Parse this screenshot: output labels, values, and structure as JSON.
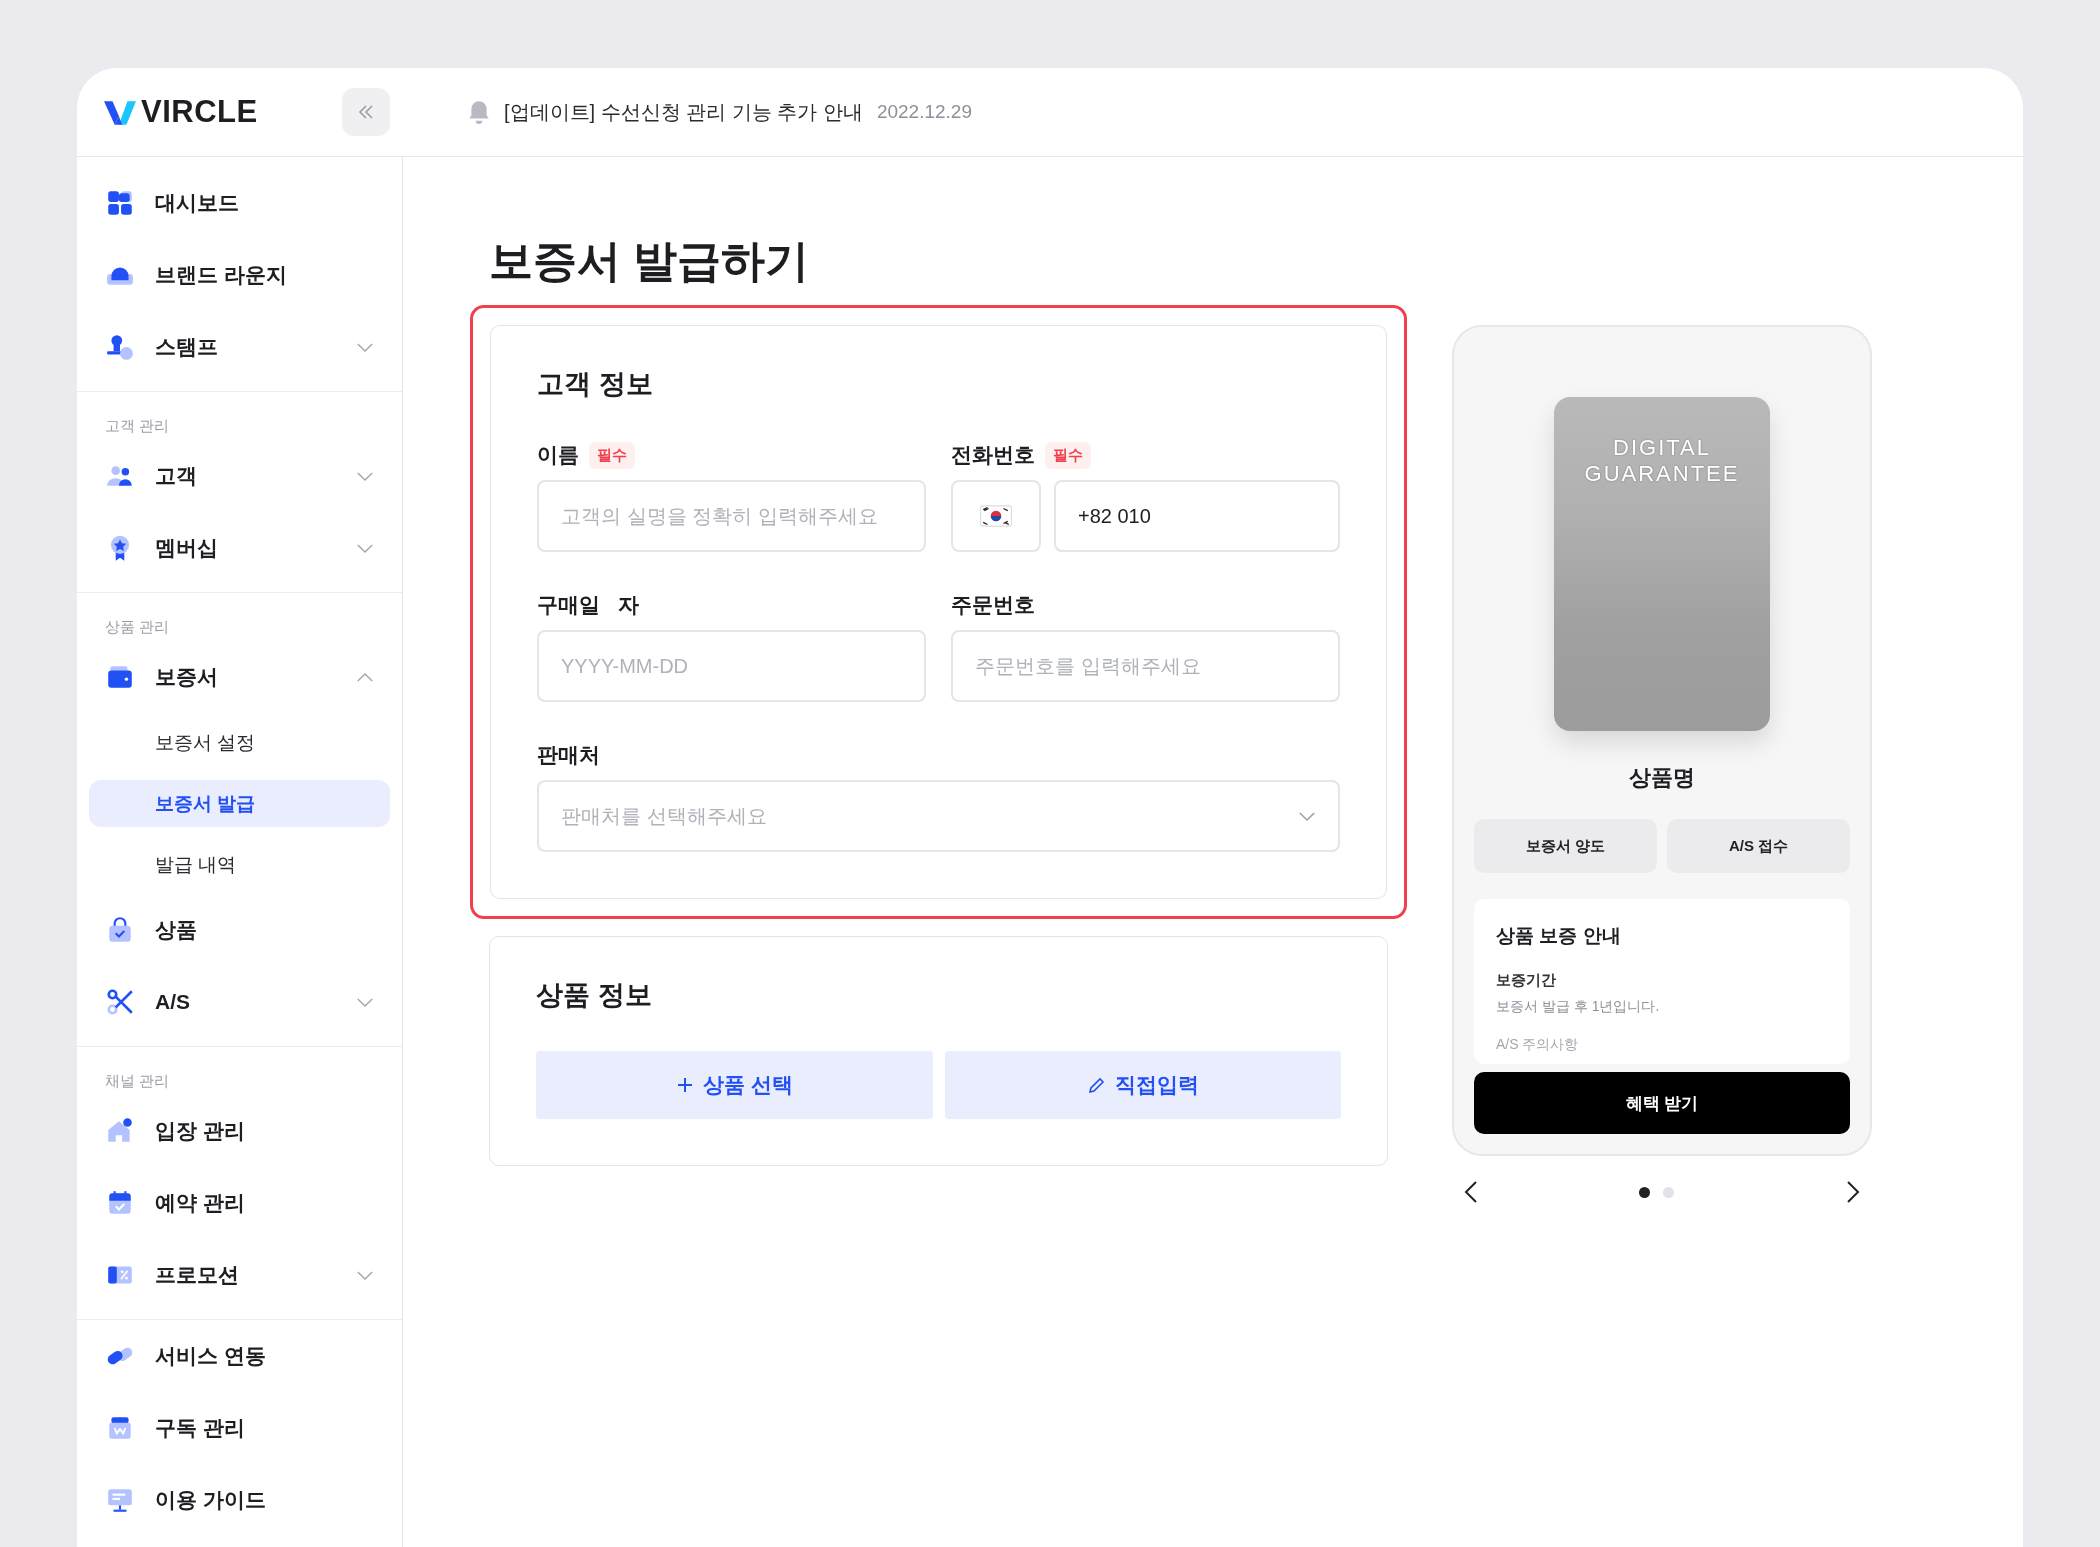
{
  "header": {
    "logo": "VIRCLE",
    "notice": "[업데이트] 수선신청 관리 기능 추가 안내",
    "date": "2022.12.29"
  },
  "sidebar": {
    "groups": [
      {
        "items": [
          {
            "label": "대시보드"
          },
          {
            "label": "브랜드 라운지"
          },
          {
            "label": "스탬프",
            "expanded": false
          }
        ]
      },
      {
        "heading": "고객 관리",
        "items": [
          {
            "label": "고객",
            "expanded": false
          },
          {
            "label": "멤버십",
            "expanded": false
          }
        ]
      },
      {
        "heading": "상품 관리",
        "items": [
          {
            "label": "보증서",
            "expanded": true,
            "children": [
              {
                "label": "보증서 설정",
                "selected": false
              },
              {
                "label": "보증서 발급",
                "selected": true
              },
              {
                "label": "발급 내역",
                "selected": false
              }
            ]
          },
          {
            "label": "상품"
          },
          {
            "label": "A/S",
            "expanded": false
          }
        ]
      },
      {
        "heading": "채널 관리",
        "items": [
          {
            "label": "입장 관리"
          },
          {
            "label": "예약 관리"
          },
          {
            "label": "프로모션",
            "expanded": false
          }
        ]
      },
      {
        "items": [
          {
            "label": "서비스 연동"
          },
          {
            "label": "구독 관리"
          },
          {
            "label": "이용 가이드"
          }
        ]
      }
    ]
  },
  "page_title": "보증서 발급하기",
  "customer_info": {
    "title": "고객 정보",
    "highlighted": true,
    "fields": [
      {
        "kind": "text",
        "label": "이름",
        "badge": "필수",
        "placeholder": "고객의 실명을 정확히 입력해주세요"
      },
      {
        "kind": "phone",
        "label": "전화번호",
        "badge": "필수",
        "value": "+82 010"
      },
      {
        "kind": "text",
        "label": "구매일   자",
        "placeholder": "YYYY-MM-DD"
      },
      {
        "kind": "text",
        "label": "주문번호",
        "placeholder": "주문번호를 입력해주세요"
      },
      {
        "kind": "select",
        "label": "판매처",
        "placeholder": "판매처를 선택해주세요"
      }
    ]
  },
  "product_info": {
    "title": "상품 정보",
    "buttons": [
      {
        "kind": "add",
        "label": "상품 선택"
      },
      {
        "kind": "edit",
        "label": "직접입력"
      }
    ]
  },
  "preview": {
    "card_text": "DIGITAL GUARANTEE",
    "product_name": "상품명",
    "actions": [
      "보증서 양도",
      "A/S 접수"
    ],
    "info": {
      "title": "상품 보증 안내",
      "items": [
        {
          "heading": "보증기간",
          "text": "보증서 발급 후 1년입니다."
        }
      ],
      "faded": "A/S 주의사항"
    },
    "cta": "혜택 받기",
    "pages": [
      {
        "selected": true
      },
      {
        "selected": false
      }
    ]
  }
}
